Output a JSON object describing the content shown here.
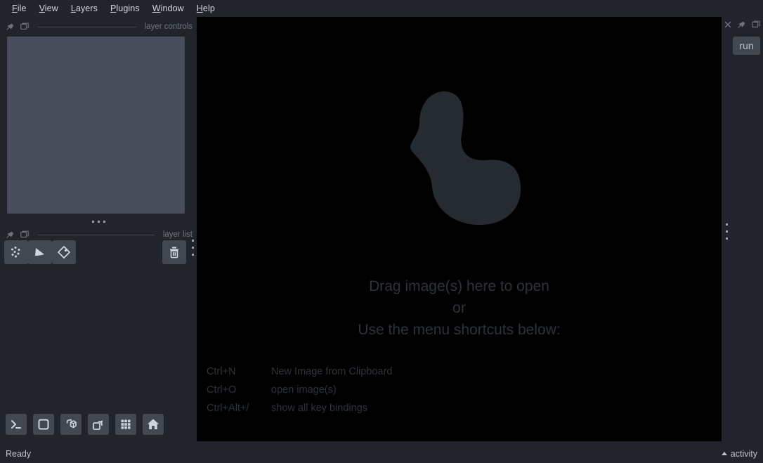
{
  "app": {
    "name": "napari",
    "theme_bg": "#21252b",
    "canvas_bg": "#000000",
    "accent": "#414851",
    "logo_color": "#262a31"
  },
  "menubar": {
    "items": [
      {
        "label": "File",
        "mnemonic": "F"
      },
      {
        "label": "View",
        "mnemonic": "V"
      },
      {
        "label": "Layers",
        "mnemonic": "L"
      },
      {
        "label": "Plugins",
        "mnemonic": "P"
      },
      {
        "label": "Window",
        "mnemonic": "W"
      },
      {
        "label": "Help",
        "mnemonic": "H"
      }
    ]
  },
  "left_dock": {
    "layer_controls": {
      "title": "layer controls"
    },
    "layer_list": {
      "title": "layer list",
      "buttons": [
        {
          "name": "new-points-layer",
          "icon": "points-icon"
        },
        {
          "name": "new-shapes-layer",
          "icon": "shapes-icon"
        },
        {
          "name": "new-labels-layer",
          "icon": "labels-icon"
        }
      ],
      "delete_button": {
        "name": "delete-layer",
        "icon": "trash-icon"
      }
    }
  },
  "viewer_buttons": [
    {
      "name": "console-button",
      "icon": "console-icon"
    },
    {
      "name": "ndisplay-button",
      "icon": "square-icon"
    },
    {
      "name": "rotate-button",
      "icon": "cube-rotate-icon"
    },
    {
      "name": "roll-dims-button",
      "icon": "roll-dims-icon"
    },
    {
      "name": "grid-view-button",
      "icon": "grid-icon"
    },
    {
      "name": "home-button",
      "icon": "home-icon"
    }
  ],
  "canvas": {
    "welcome": {
      "line1": "Drag image(s) here to open",
      "line2": "or",
      "line3": "Use the menu shortcuts below:"
    },
    "shortcuts": [
      {
        "key": "Ctrl+N",
        "description": "New Image from Clipboard"
      },
      {
        "key": "Ctrl+O",
        "description": "open image(s)"
      },
      {
        "key": "Ctrl+Alt+/",
        "description": "show all key bindings"
      }
    ]
  },
  "right_dock": {
    "run_label": "run"
  },
  "statusbar": {
    "status": "Ready",
    "activity_label": "activity"
  }
}
